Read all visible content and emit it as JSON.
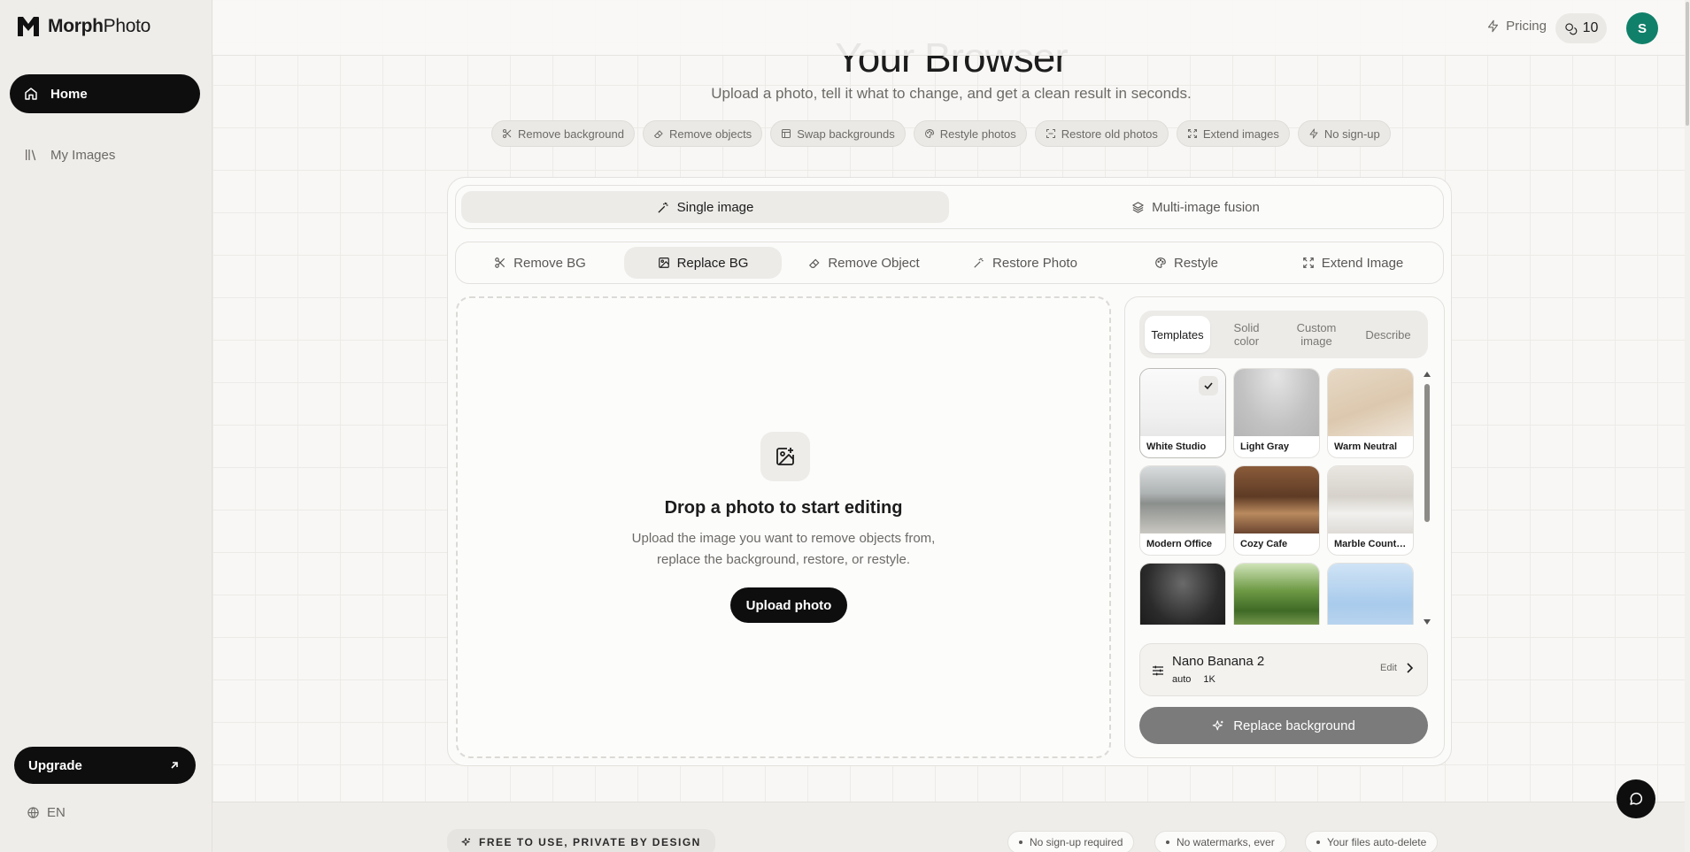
{
  "app": {
    "logo_bold": "Morph",
    "logo_light": "Photo"
  },
  "sidebar": {
    "items": [
      {
        "label": "Home",
        "icon": "home-icon",
        "active": true
      },
      {
        "label": "My Images",
        "icon": "images-icon",
        "active": false
      }
    ],
    "upgrade_label": "Upgrade",
    "language": "EN"
  },
  "topbar": {
    "pricing_label": "Pricing",
    "credits": "10",
    "avatar_initial": "S"
  },
  "hero": {
    "title": "Your Browser",
    "subtitle": "Upload a photo, tell it what to change, and get a clean result in seconds.",
    "chips": [
      {
        "label": "Remove background",
        "icon": "scissors-icon"
      },
      {
        "label": "Remove objects",
        "icon": "eraser-icon"
      },
      {
        "label": "Swap backgrounds",
        "icon": "layout-icon"
      },
      {
        "label": "Restyle photos",
        "icon": "palette-icon"
      },
      {
        "label": "Restore old photos",
        "icon": "scan-icon"
      },
      {
        "label": "Extend images",
        "icon": "expand-icon"
      },
      {
        "label": "No sign-up",
        "icon": "bolt-icon"
      }
    ]
  },
  "modes": [
    {
      "label": "Single image",
      "active": true
    },
    {
      "label": "Multi-image fusion",
      "active": false
    }
  ],
  "tools": [
    {
      "label": "Remove BG",
      "icon": "scissors-icon"
    },
    {
      "label": "Replace BG",
      "icon": "image-swap-icon",
      "active": true
    },
    {
      "label": "Remove Object",
      "icon": "eraser-icon"
    },
    {
      "label": "Restore Photo",
      "icon": "wand-icon"
    },
    {
      "label": "Restyle",
      "icon": "palette-icon"
    },
    {
      "label": "Extend Image",
      "icon": "expand-icon"
    }
  ],
  "dropzone": {
    "title": "Drop a photo to start editing",
    "desc_line1": "Upload the image you want to remove objects from,",
    "desc_line2": "replace the background, restore, or restyle.",
    "button": "Upload photo"
  },
  "panel": {
    "tabs": [
      "Templates",
      "Solid color",
      "Custom image",
      "Describe"
    ],
    "active_tab": "Templates",
    "templates": [
      {
        "name": "White Studio",
        "selected": true
      },
      {
        "name": "Light Gray"
      },
      {
        "name": "Warm Neutral"
      },
      {
        "name": "Modern Office"
      },
      {
        "name": "Cozy Cafe"
      },
      {
        "name": "Marble Countertop"
      },
      {
        "name": ""
      },
      {
        "name": ""
      },
      {
        "name": ""
      }
    ],
    "model": {
      "name": "Nano Banana 2",
      "ratio": "auto",
      "resolution": "1K",
      "edit_label": "Edit"
    },
    "action_button": "Replace background"
  },
  "footer": {
    "badge": "FREE TO USE, PRIVATE BY DESIGN",
    "pills": [
      "No sign-up required",
      "No watermarks, ever",
      "Your files auto-delete"
    ]
  }
}
